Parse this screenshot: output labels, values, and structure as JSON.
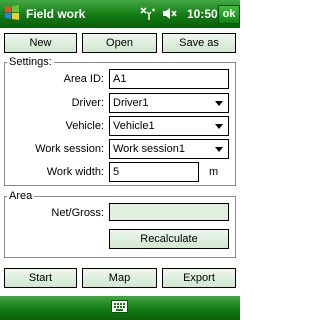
{
  "titlebar": {
    "title": "Field work",
    "time": "10:50",
    "ok_label": "ok",
    "icons": [
      "windows-start-flag-icon",
      "network-signal-icon",
      "speaker-muted-icon"
    ]
  },
  "toolbar": {
    "new_label": "New",
    "open_label": "Open",
    "saveas_label": "Save as"
  },
  "settings": {
    "legend": "Settings:",
    "area_id_label": "Area ID:",
    "area_id_value": "A1",
    "driver_label": "Driver:",
    "driver_value": "Driver1",
    "vehicle_label": "Vehicle:",
    "vehicle_value": "Vehicle1",
    "work_session_label": "Work session:",
    "work_session_value": "Work session1",
    "work_width_label": "Work width:",
    "work_width_value": "5",
    "work_width_unit": "m"
  },
  "area": {
    "legend": "Area",
    "net_gross_label": "Net/Gross:",
    "net_gross_value": "",
    "recalculate_label": "Recalculate"
  },
  "actions": {
    "start_label": "Start",
    "map_label": "Map",
    "export_label": "Export"
  },
  "bottombar": {
    "icons": [
      "keyboard-icon"
    ]
  },
  "colors": {
    "titlebar_green": "#137a13",
    "button_fill": "#d8ecd8",
    "group_border": "#8a8a8a"
  }
}
